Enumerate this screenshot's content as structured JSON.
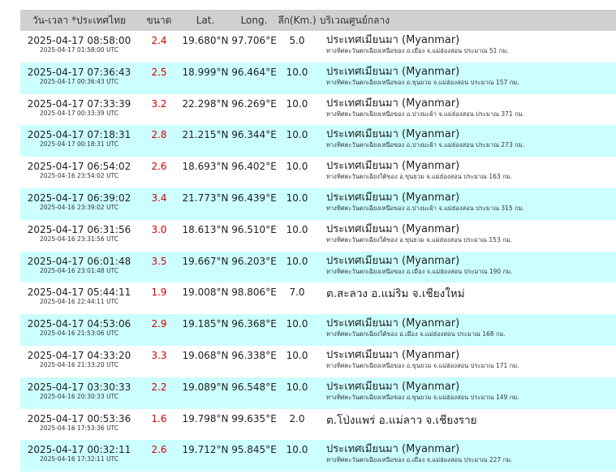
{
  "headers": {
    "datetime": "วัน-เวลา *ประเทศไทย",
    "magnitude": "ขนาด",
    "lat": "Lat.",
    "lon": "Long.",
    "depth": "ลึก(Km.)",
    "region": "บริเวณศูนย์กลาง"
  },
  "rows": [
    {
      "dt": "2025-04-17 08:58:00",
      "utc": "2025-04-17 01:58:00 UTC",
      "mag": "2.4",
      "lat": "19.680°N",
      "lon": "97.706°E",
      "depth": "5.0",
      "region": "ประเทศเมียนมา (Myanmar)",
      "detail": "ทางทิศตะวันตกเฉียงเหนือของ อ.เมือง จ.แม่ฮ่องสอน ประมาณ 51 กม."
    },
    {
      "dt": "2025-04-17 07:36:43",
      "utc": "2025-04-17 00:36:43 UTC",
      "mag": "2.5",
      "lat": "18.999°N",
      "lon": "96.464°E",
      "depth": "10.0",
      "region": "ประเทศเมียนมา (Myanmar)",
      "detail": "ทางทิศตะวันตกเฉียงเหนือของ อ.ขุนยวม จ.แม่ฮ่องสอน ประมาณ 157 กม."
    },
    {
      "dt": "2025-04-17 07:33:39",
      "utc": "2025-04-17 00:33:39 UTC",
      "mag": "3.2",
      "lat": "22.298°N",
      "lon": "96.269°E",
      "depth": "10.0",
      "region": "ประเทศเมียนมา (Myanmar)",
      "detail": "ทางทิศตะวันตกเฉียงเหนือของ อ.ปางมะผ้า จ.แม่ฮ่องสอน ประมาณ 371 กม."
    },
    {
      "dt": "2025-04-17 07:18:31",
      "utc": "2025-04-17 00:18:31 UTC",
      "mag": "2.8",
      "lat": "21.215°N",
      "lon": "96.344°E",
      "depth": "10.0",
      "region": "ประเทศเมียนมา (Myanmar)",
      "detail": "ทางทิศตะวันตกเฉียงเหนือของ อ.ปางมะผ้า จ.แม่ฮ่องสอน ประมาณ 273 กม."
    },
    {
      "dt": "2025-04-17 06:54:02",
      "utc": "2025-04-16 23:54:02 UTC",
      "mag": "2.6",
      "lat": "18.693°N",
      "lon": "96.402°E",
      "depth": "10.0",
      "region": "ประเทศเมียนมา (Myanmar)",
      "detail": "ทางทิศตะวันตกเฉียงใต้ของ อ.ขุนยวม จ.แม่ฮ่องสอน ประมาณ 163 กม."
    },
    {
      "dt": "2025-04-17 06:39:02",
      "utc": "2025-04-16 23:39:02 UTC",
      "mag": "3.4",
      "lat": "21.773°N",
      "lon": "96.439°E",
      "depth": "10.0",
      "region": "ประเทศเมียนมา (Myanmar)",
      "detail": "ทางทิศตะวันตกเฉียงเหนือของ อ.ปางมะผ้า จ.แม่ฮ่องสอน ประมาณ 315 กม."
    },
    {
      "dt": "2025-04-17 06:31:56",
      "utc": "2025-04-16 23:31:56 UTC",
      "mag": "3.0",
      "lat": "18.613°N",
      "lon": "96.510°E",
      "depth": "10.0",
      "region": "ประเทศเมียนมา (Myanmar)",
      "detail": "ทางทิศตะวันตกเฉียงใต้ของ อ.ขุนยวม จ.แม่ฮ่องสอน ประมาณ 153 กม."
    },
    {
      "dt": "2025-04-17 06:01:48",
      "utc": "2025-04-16 23:01:48 UTC",
      "mag": "3.5",
      "lat": "19.667°N",
      "lon": "96.203°E",
      "depth": "10.0",
      "region": "ประเทศเมียนมา (Myanmar)",
      "detail": "ทางทิศตะวันตกเฉียงเหนือของ อ.เมือง จ.แม่ฮ่องสอน ประมาณ 190 กม."
    },
    {
      "dt": "2025-04-17 05:44:11",
      "utc": "2025-04-16 22:44:11 UTC",
      "mag": "1.9",
      "lat": "19.008°N",
      "lon": "98.806°E",
      "depth": "7.0",
      "region": "ต.สะลวง อ.แม่ริม จ.เชียงใหม่",
      "detail": ""
    },
    {
      "dt": "2025-04-17 04:53:06",
      "utc": "2025-04-16 21:53:06 UTC",
      "mag": "2.9",
      "lat": "19.185°N",
      "lon": "96.368°E",
      "depth": "10.0",
      "region": "ประเทศเมียนมา (Myanmar)",
      "detail": "ทางทิศตะวันตกเฉียงใต้ของ อ.เมือง จ.แม่ฮ่องสอน ประมาณ 168 กม."
    },
    {
      "dt": "2025-04-17 04:33:20",
      "utc": "2025-04-16 21:33:20 UTC",
      "mag": "3.3",
      "lat": "19.068°N",
      "lon": "96.338°E",
      "depth": "10.0",
      "region": "ประเทศเมียนมา (Myanmar)",
      "detail": "ทางทิศตะวันตกเฉียงเหนือของ อ.ขุนยวม จ.แม่ฮ่องสอน ประมาณ 171 กม."
    },
    {
      "dt": "2025-04-17 03:30:33",
      "utc": "2025-04-16 20:30:33 UTC",
      "mag": "2.2",
      "lat": "19.089°N",
      "lon": "96.548°E",
      "depth": "10.0",
      "region": "ประเทศเมียนมา (Myanmar)",
      "detail": "ทางทิศตะวันตกเฉียงเหนือของ อ.ขุนยวม จ.แม่ฮ่องสอน ประมาณ 149 กม."
    },
    {
      "dt": "2025-04-17 00:53:36",
      "utc": "2025-04-16 17:53:36 UTC",
      "mag": "1.6",
      "lat": "19.798°N",
      "lon": "99.635°E",
      "depth": "2.0",
      "region": "ต.โป่งแพร่ อ.แม่ลาว จ.เชียงราย",
      "detail": ""
    },
    {
      "dt": "2025-04-17 00:32:11",
      "utc": "2025-04-16 17:32:11 UTC",
      "mag": "2.6",
      "lat": "19.712°N",
      "lon": "95.845°E",
      "depth": "10.0",
      "region": "ประเทศเมียนมา (Myanmar)",
      "detail": "ทางทิศตะวันตกเฉียงเหนือของ อ.เมือง จ.แม่ฮ่องสอน ประมาณ 227 กม."
    }
  ]
}
